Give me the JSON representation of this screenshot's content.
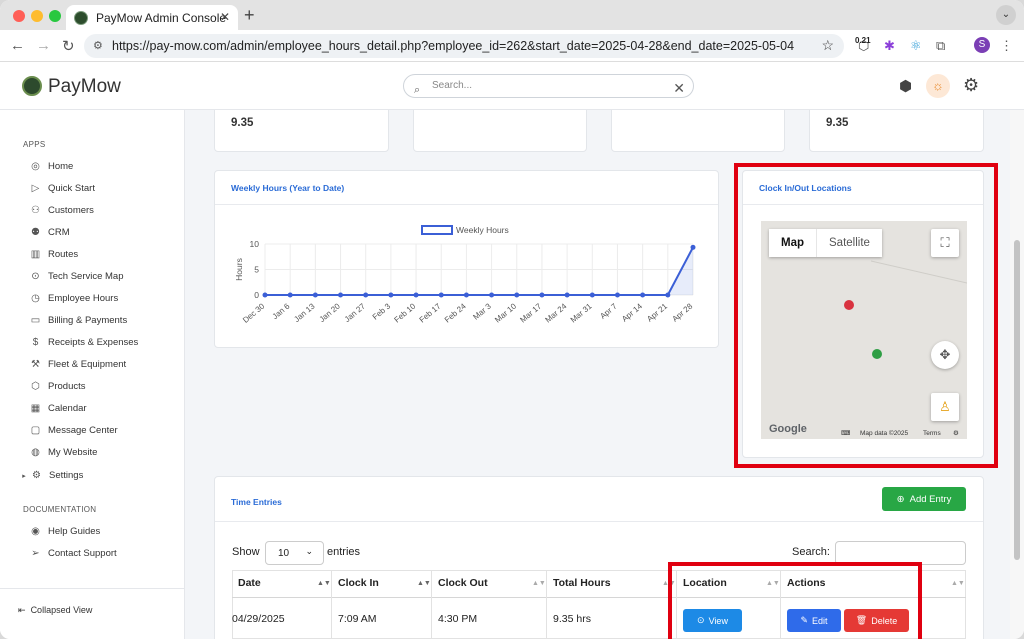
{
  "browser": {
    "tab_title": "PayMow Admin Console",
    "url": "https://pay-mow.com/admin/employee_hours_detail.php?employee_id=262&start_date=2025-04-28&end_date=2025-05-04",
    "ext_badge": "0.21",
    "profile_initial": "S"
  },
  "header": {
    "brand": "PayMow",
    "search_placeholder": "Search..."
  },
  "sidebar": {
    "apps_label": "APPS",
    "items": [
      "Home",
      "Quick Start",
      "Customers",
      "CRM",
      "Routes",
      "Tech Service Map",
      "Employee Hours",
      "Billing & Payments",
      "Receipts & Expenses",
      "Fleet & Equipment",
      "Products",
      "Calendar",
      "Message Center",
      "My Website",
      "Settings"
    ],
    "docs_label": "DOCUMENTATION",
    "doc_items": [
      "Help Guides",
      "Contact Support"
    ],
    "collapsed_view": "Collapsed View"
  },
  "stats": {
    "first_value": "9.35",
    "last_value": "9.35"
  },
  "weekly_card": {
    "title": "Weekly Hours (Year to Date)"
  },
  "chart_data": {
    "type": "line",
    "title": "",
    "xlabel": "",
    "ylabel": "Hours",
    "categories": [
      "Dec 30",
      "Jan 6",
      "Jan 13",
      "Jan 20",
      "Jan 27",
      "Feb 3",
      "Feb 10",
      "Feb 17",
      "Feb 24",
      "Mar 3",
      "Mar 10",
      "Mar 17",
      "Mar 24",
      "Mar 31",
      "Apr 7",
      "Apr 14",
      "Apr 21",
      "Apr 28"
    ],
    "series": [
      {
        "name": "Weekly Hours",
        "values": [
          0,
          0,
          0,
          0,
          0,
          0,
          0,
          0,
          0,
          0,
          0,
          0,
          0,
          0,
          0,
          0,
          0,
          9.35
        ]
      }
    ],
    "ylim": [
      0,
      10
    ],
    "yticks": [
      0,
      5,
      10
    ],
    "grid": true,
    "legend": "top-center",
    "color": "#3b5fd6"
  },
  "map_card": {
    "title": "Clock In/Out Locations",
    "map_label": "Map",
    "satellite_label": "Satellite",
    "google": "Google",
    "map_data": "Map data ©2025",
    "terms": "Terms"
  },
  "time_entries": {
    "title": "Time Entries",
    "add_entry": "Add Entry",
    "show_label": "Show",
    "entries_count": "10",
    "entries_label": "entries",
    "search_label": "Search:",
    "columns": [
      "Date",
      "Clock In",
      "Clock Out",
      "Total Hours",
      "Location",
      "Actions"
    ],
    "rows": [
      {
        "date": "04/29/2025",
        "clock_in": "7:09 AM",
        "clock_out": "4:30 PM",
        "total_hours": "9.35 hrs"
      }
    ],
    "view_btn": "View",
    "edit_btn": "Edit",
    "delete_btn": "Delete"
  },
  "colors": {
    "accent": "#2a6bd6",
    "green": "#28a745",
    "danger": "#e53935",
    "highlight": "#e00010"
  }
}
